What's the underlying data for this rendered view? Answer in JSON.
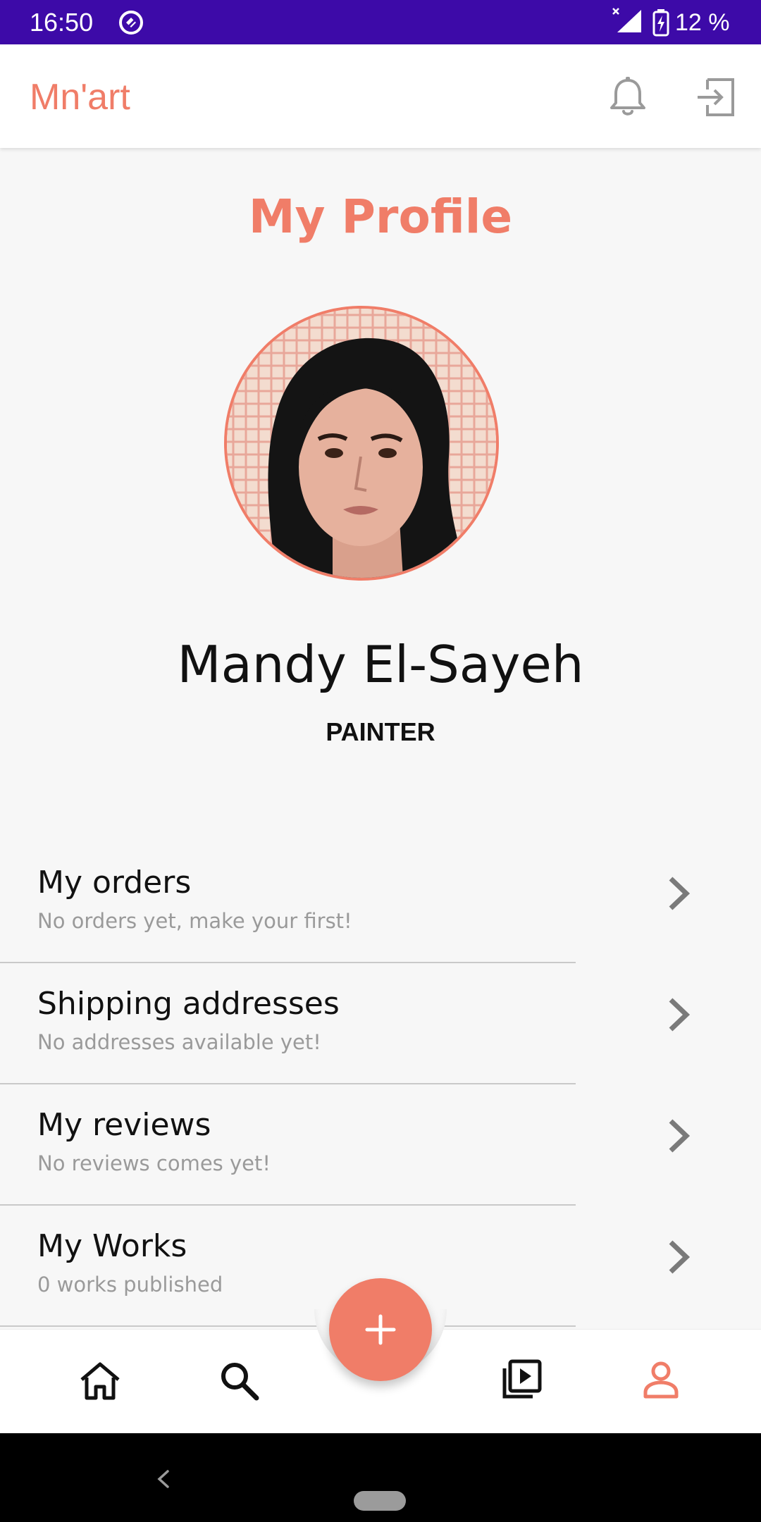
{
  "status_bar": {
    "time": "16:50",
    "battery": "12 %",
    "background": "#3d0aa8"
  },
  "app_bar": {
    "title": "Mn'art",
    "actions": [
      "bell-icon",
      "logout-icon"
    ]
  },
  "profile": {
    "page_title": "My Profile",
    "name": "Mandy El-Sayeh",
    "role": "PAINTER"
  },
  "menu": {
    "items": [
      {
        "title": "My orders",
        "subtitle": "No orders yet, make your first!"
      },
      {
        "title": "Shipping addresses",
        "subtitle": "No addresses available yet!"
      },
      {
        "title": "My reviews",
        "subtitle": "No reviews comes yet!"
      },
      {
        "title": "My Works",
        "subtitle": "0 works published"
      }
    ]
  },
  "bottom_nav": {
    "items": [
      "home-icon",
      "search-icon",
      "add-icon",
      "media-library-icon",
      "profile-icon"
    ],
    "active": "profile-icon"
  },
  "colors": {
    "accent": "#f07d68",
    "text": "#111111",
    "muted": "#9a9a9a",
    "background": "#f7f7f7"
  }
}
